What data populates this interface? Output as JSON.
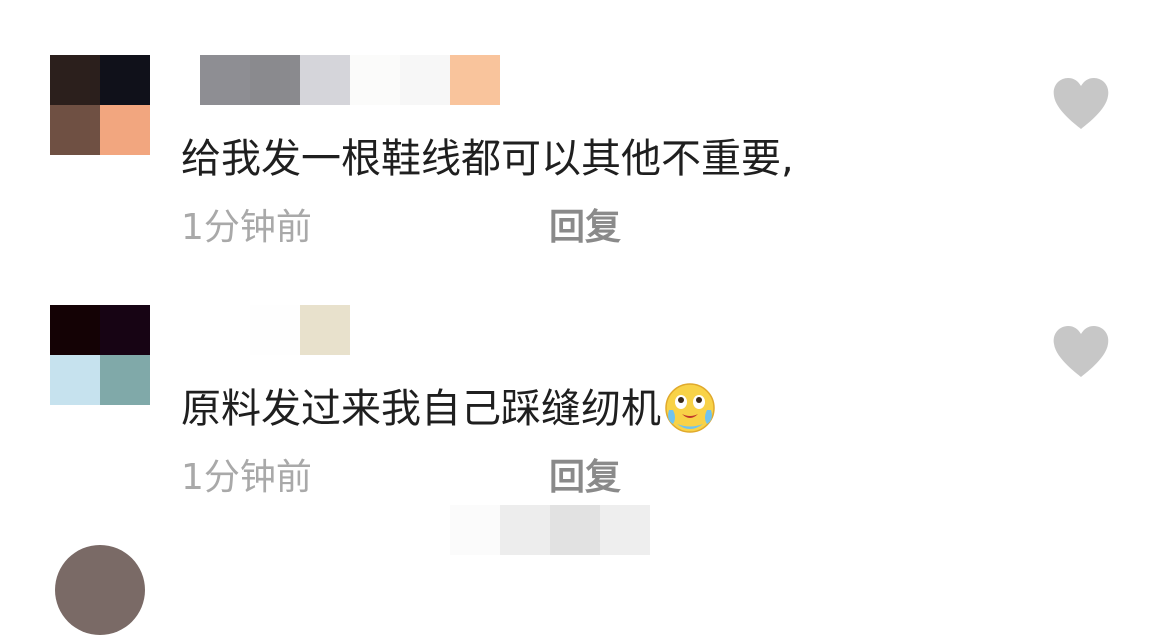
{
  "comments": [
    {
      "avatar_colors": [
        "#2b1f1c",
        "#10111a",
        "#6f5043",
        "#f2a67f"
      ],
      "name_mosaic_colors": [
        "#8e8e93",
        "#8a8a8e",
        "#d5d5da",
        "#fbfbfa",
        "#f7f7f7",
        "#f9c49c"
      ],
      "text": "给我发一根鞋线都可以其他不重要,",
      "time": "1分钟前",
      "reply_label": "回复",
      "like_icon": "heart-icon"
    },
    {
      "avatar_colors": [
        "#140205",
        "#170414",
        "#c6e2ee",
        "#80a9a9"
      ],
      "name_mosaic_colors": [
        "#ffffff",
        "#fefefe",
        "#e8e1cc"
      ],
      "text": "原料发过来我自己踩缝纫机",
      "emoji": "crying-laughing-emoji",
      "time": "1分钟前",
      "reply_label": "回复",
      "like_icon": "heart-icon"
    }
  ],
  "partial_comment": {
    "name_mosaic_colors": [
      "#fbfbfb",
      "#ededed",
      "#e2e2e2",
      "#eeeeee"
    ]
  }
}
